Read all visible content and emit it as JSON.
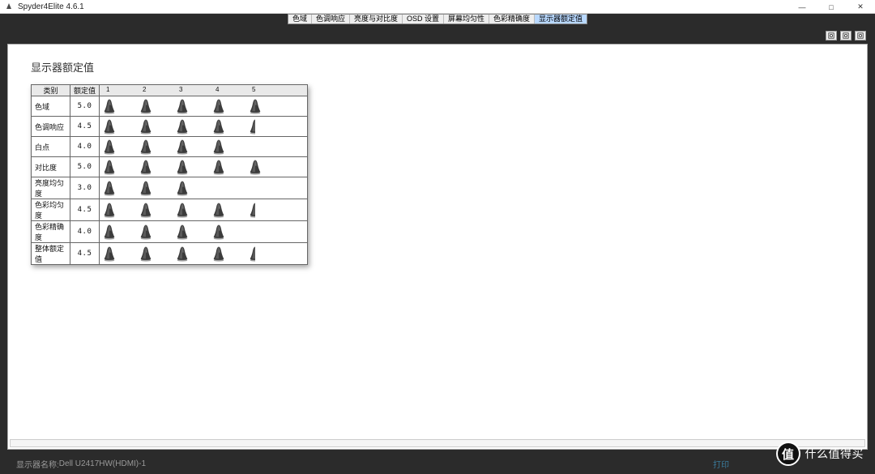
{
  "window": {
    "title": "Spyder4Elite 4.6.1",
    "controls": {
      "min": "—",
      "max": "□",
      "close": "✕"
    }
  },
  "tabs": [
    {
      "label": "色域",
      "active": false
    },
    {
      "label": "色调响应",
      "active": false
    },
    {
      "label": "亮度与对比度",
      "active": false
    },
    {
      "label": "OSD 设置",
      "active": false
    },
    {
      "label": "屏幕均匀性",
      "active": false
    },
    {
      "label": "色彩精确度",
      "active": false
    },
    {
      "label": "显示器额定值",
      "active": true
    }
  ],
  "toolbar_icons": [
    "tool-a",
    "tool-b",
    "tool-c"
  ],
  "page": {
    "title": "显示器额定值",
    "headers": {
      "category": "类别",
      "value": "额定值",
      "levels": [
        "1",
        "2",
        "3",
        "4",
        "5"
      ]
    },
    "rows": [
      {
        "category": "色域",
        "value": "5.0",
        "rating": 5.0
      },
      {
        "category": "色调响应",
        "value": "4.5",
        "rating": 4.5
      },
      {
        "category": "白点",
        "value": "4.0",
        "rating": 4.0
      },
      {
        "category": "对比度",
        "value": "5.0",
        "rating": 5.0
      },
      {
        "category": "亮度均匀度",
        "value": "3.0",
        "rating": 3.0
      },
      {
        "category": "色彩均匀度",
        "value": "4.5",
        "rating": 4.5
      },
      {
        "category": "色彩精确度",
        "value": "4.0",
        "rating": 4.0
      },
      {
        "category": "整体额定值",
        "value": "4.5",
        "rating": 4.5
      }
    ]
  },
  "status": {
    "label": "显示器名称: ",
    "monitor": "Dell U2417HW(HDMI)-1",
    "action": "打印"
  },
  "watermark": {
    "logo_char": "值",
    "text": "什么值得买"
  },
  "chart_data": {
    "type": "table",
    "title": "显示器额定值",
    "columns": [
      "类别",
      "额定值"
    ],
    "rows": [
      [
        "色域",
        5.0
      ],
      [
        "色调响应",
        4.5
      ],
      [
        "白点",
        4.0
      ],
      [
        "对比度",
        5.0
      ],
      [
        "亮度均匀度",
        3.0
      ],
      [
        "色彩均匀度",
        4.5
      ],
      [
        "色彩精确度",
        4.0
      ],
      [
        "整体额定值",
        4.5
      ]
    ],
    "scale": {
      "min": 1,
      "max": 5,
      "step": 0.5
    }
  }
}
